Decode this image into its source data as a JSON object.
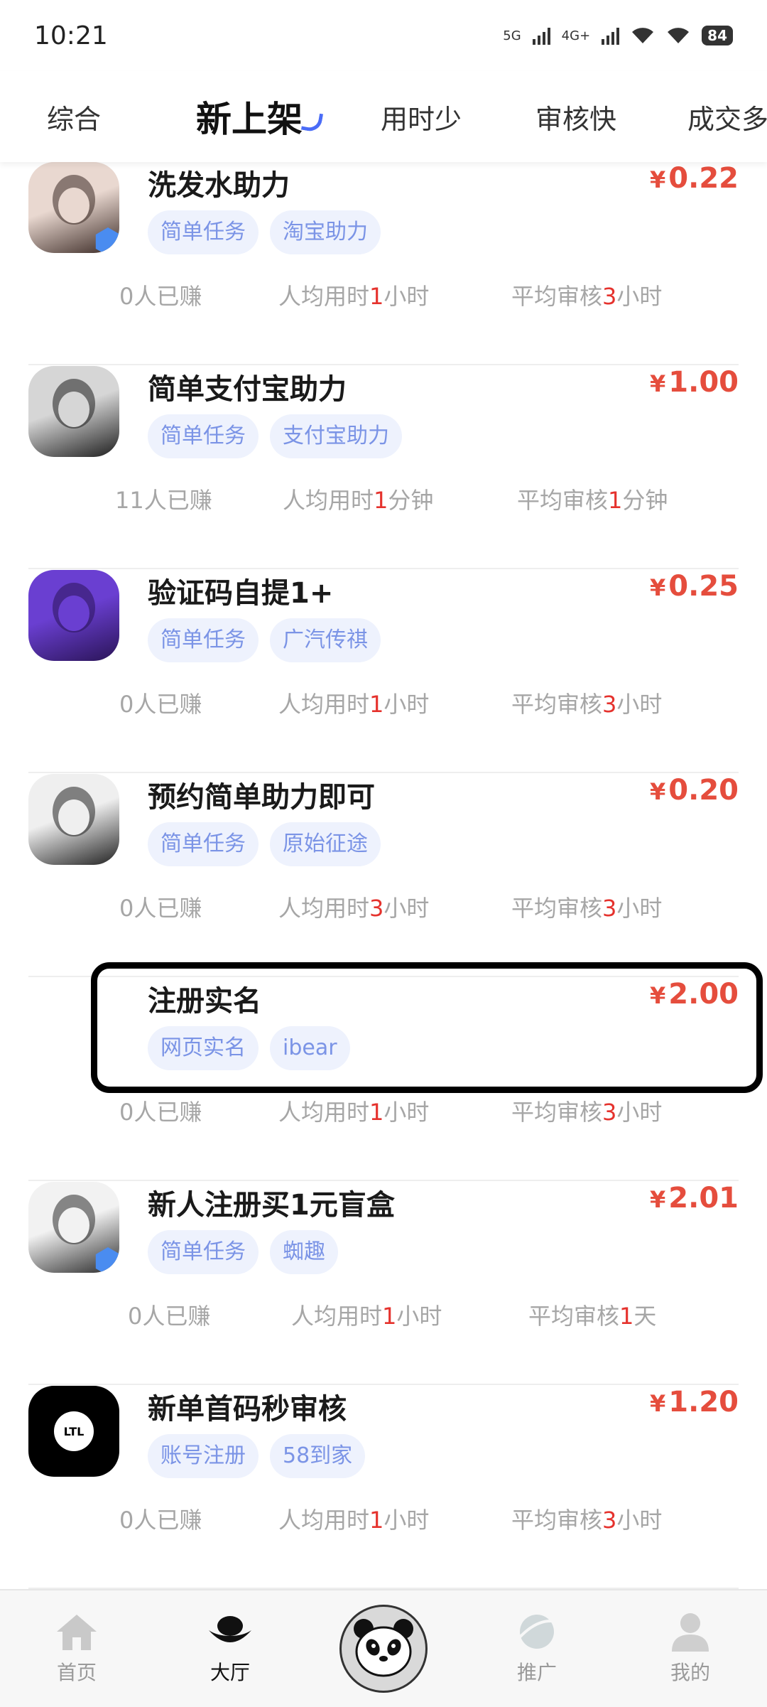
{
  "status_bar": {
    "time": "10:21",
    "network1": "5G",
    "network2": "4G+",
    "battery": "84"
  },
  "tabs": [
    {
      "label": "综合",
      "active": false
    },
    {
      "label": "新上架",
      "active": true
    },
    {
      "label": "用时少",
      "active": false
    },
    {
      "label": "审核快",
      "active": false
    },
    {
      "label": "成交多",
      "active": false
    }
  ],
  "currency_symbol": "¥",
  "tasks": [
    {
      "title": "洗发水助力",
      "price": "0.22",
      "tags": [
        "简单任务",
        "淘宝助力"
      ],
      "earned": "0人已赚",
      "avg_time_prefix": "人均用时",
      "avg_time_num": "1",
      "avg_time_unit": "小时",
      "avg_review_prefix": "平均审核",
      "avg_review_num": "3",
      "avg_review_unit": "小时",
      "avatar_colors": [
        "#e9d8d0",
        "#3b2a25"
      ],
      "verified": true
    },
    {
      "title": "简单支付宝助力",
      "price": "1.00",
      "tags": [
        "简单任务",
        "支付宝助力"
      ],
      "earned": "11人已赚",
      "avg_time_prefix": "人均用时",
      "avg_time_num": "1",
      "avg_time_unit": "分钟",
      "avg_review_prefix": "平均审核",
      "avg_review_num": "1",
      "avg_review_unit": "分钟",
      "avatar_colors": [
        "#d6d6d6",
        "#1e1e1e"
      ],
      "verified": false
    },
    {
      "title": "验证码自提1+",
      "price": "0.25",
      "tags": [
        "简单任务",
        "广汽传祺"
      ],
      "earned": "0人已赚",
      "avg_time_prefix": "人均用时",
      "avg_time_num": "1",
      "avg_time_unit": "小时",
      "avg_review_prefix": "平均审核",
      "avg_review_num": "3",
      "avg_review_unit": "小时",
      "avatar_colors": [
        "#6a3fd1",
        "#2a1457"
      ],
      "verified": false
    },
    {
      "title": "预约简单助力即可",
      "price": "0.20",
      "tags": [
        "简单任务",
        "原始征途"
      ],
      "earned": "0人已赚",
      "avg_time_prefix": "人均用时",
      "avg_time_num": "3",
      "avg_time_unit": "小时",
      "avg_review_prefix": "平均审核",
      "avg_review_num": "3",
      "avg_review_unit": "小时",
      "avatar_colors": [
        "#efefef",
        "#222222"
      ],
      "verified": false
    },
    {
      "title": "注册实名",
      "price": "2.00",
      "tags": [
        "网页实名",
        "ibear"
      ],
      "earned": "0人已赚",
      "avg_time_prefix": "人均用时",
      "avg_time_num": "1",
      "avg_time_unit": "小时",
      "avg_review_prefix": "平均审核",
      "avg_review_num": "3",
      "avg_review_unit": "小时",
      "avatar_colors": [
        "#ffffff",
        "#ffffff"
      ],
      "verified": false
    },
    {
      "title": "新人注册买1元盲盒",
      "price": "2.01",
      "tags": [
        "简单任务",
        "蜘趣"
      ],
      "earned": "0人已赚",
      "avg_time_prefix": "人均用时",
      "avg_time_num": "1",
      "avg_time_unit": "小时",
      "avg_review_prefix": "平均审核",
      "avg_review_num": "1",
      "avg_review_unit": "天",
      "avatar_colors": [
        "#f2f2f2",
        "#2b2b2b"
      ],
      "verified": true
    },
    {
      "title": "新单首码秒审核",
      "price": "1.20",
      "tags": [
        "账号注册",
        "58到家"
      ],
      "earned": "0人已赚",
      "avg_time_prefix": "人均用时",
      "avg_time_num": "1",
      "avg_time_unit": "小时",
      "avg_review_prefix": "平均审核",
      "avg_review_num": "3",
      "avg_review_unit": "小时",
      "avatar_colors": [
        "#000000",
        "#000000"
      ],
      "avatar_text": "LTL",
      "verified": false
    }
  ],
  "bottom_nav": [
    {
      "label": "首页",
      "icon": "home-icon",
      "active": false
    },
    {
      "label": "大厅",
      "icon": "ingot-icon",
      "active": true
    },
    {
      "label": "",
      "icon": "panda-icon",
      "active": false
    },
    {
      "label": "推广",
      "icon": "planet-icon",
      "active": false
    },
    {
      "label": "我的",
      "icon": "user-icon",
      "active": false
    }
  ],
  "colors": {
    "accent": "#4a6cf7",
    "price": "#e54d3d",
    "tag_bg": "#eef2fd",
    "tag_text": "#7b94e6",
    "stat_text": "#a6a6a6",
    "highlight_num": "#e5322d"
  }
}
